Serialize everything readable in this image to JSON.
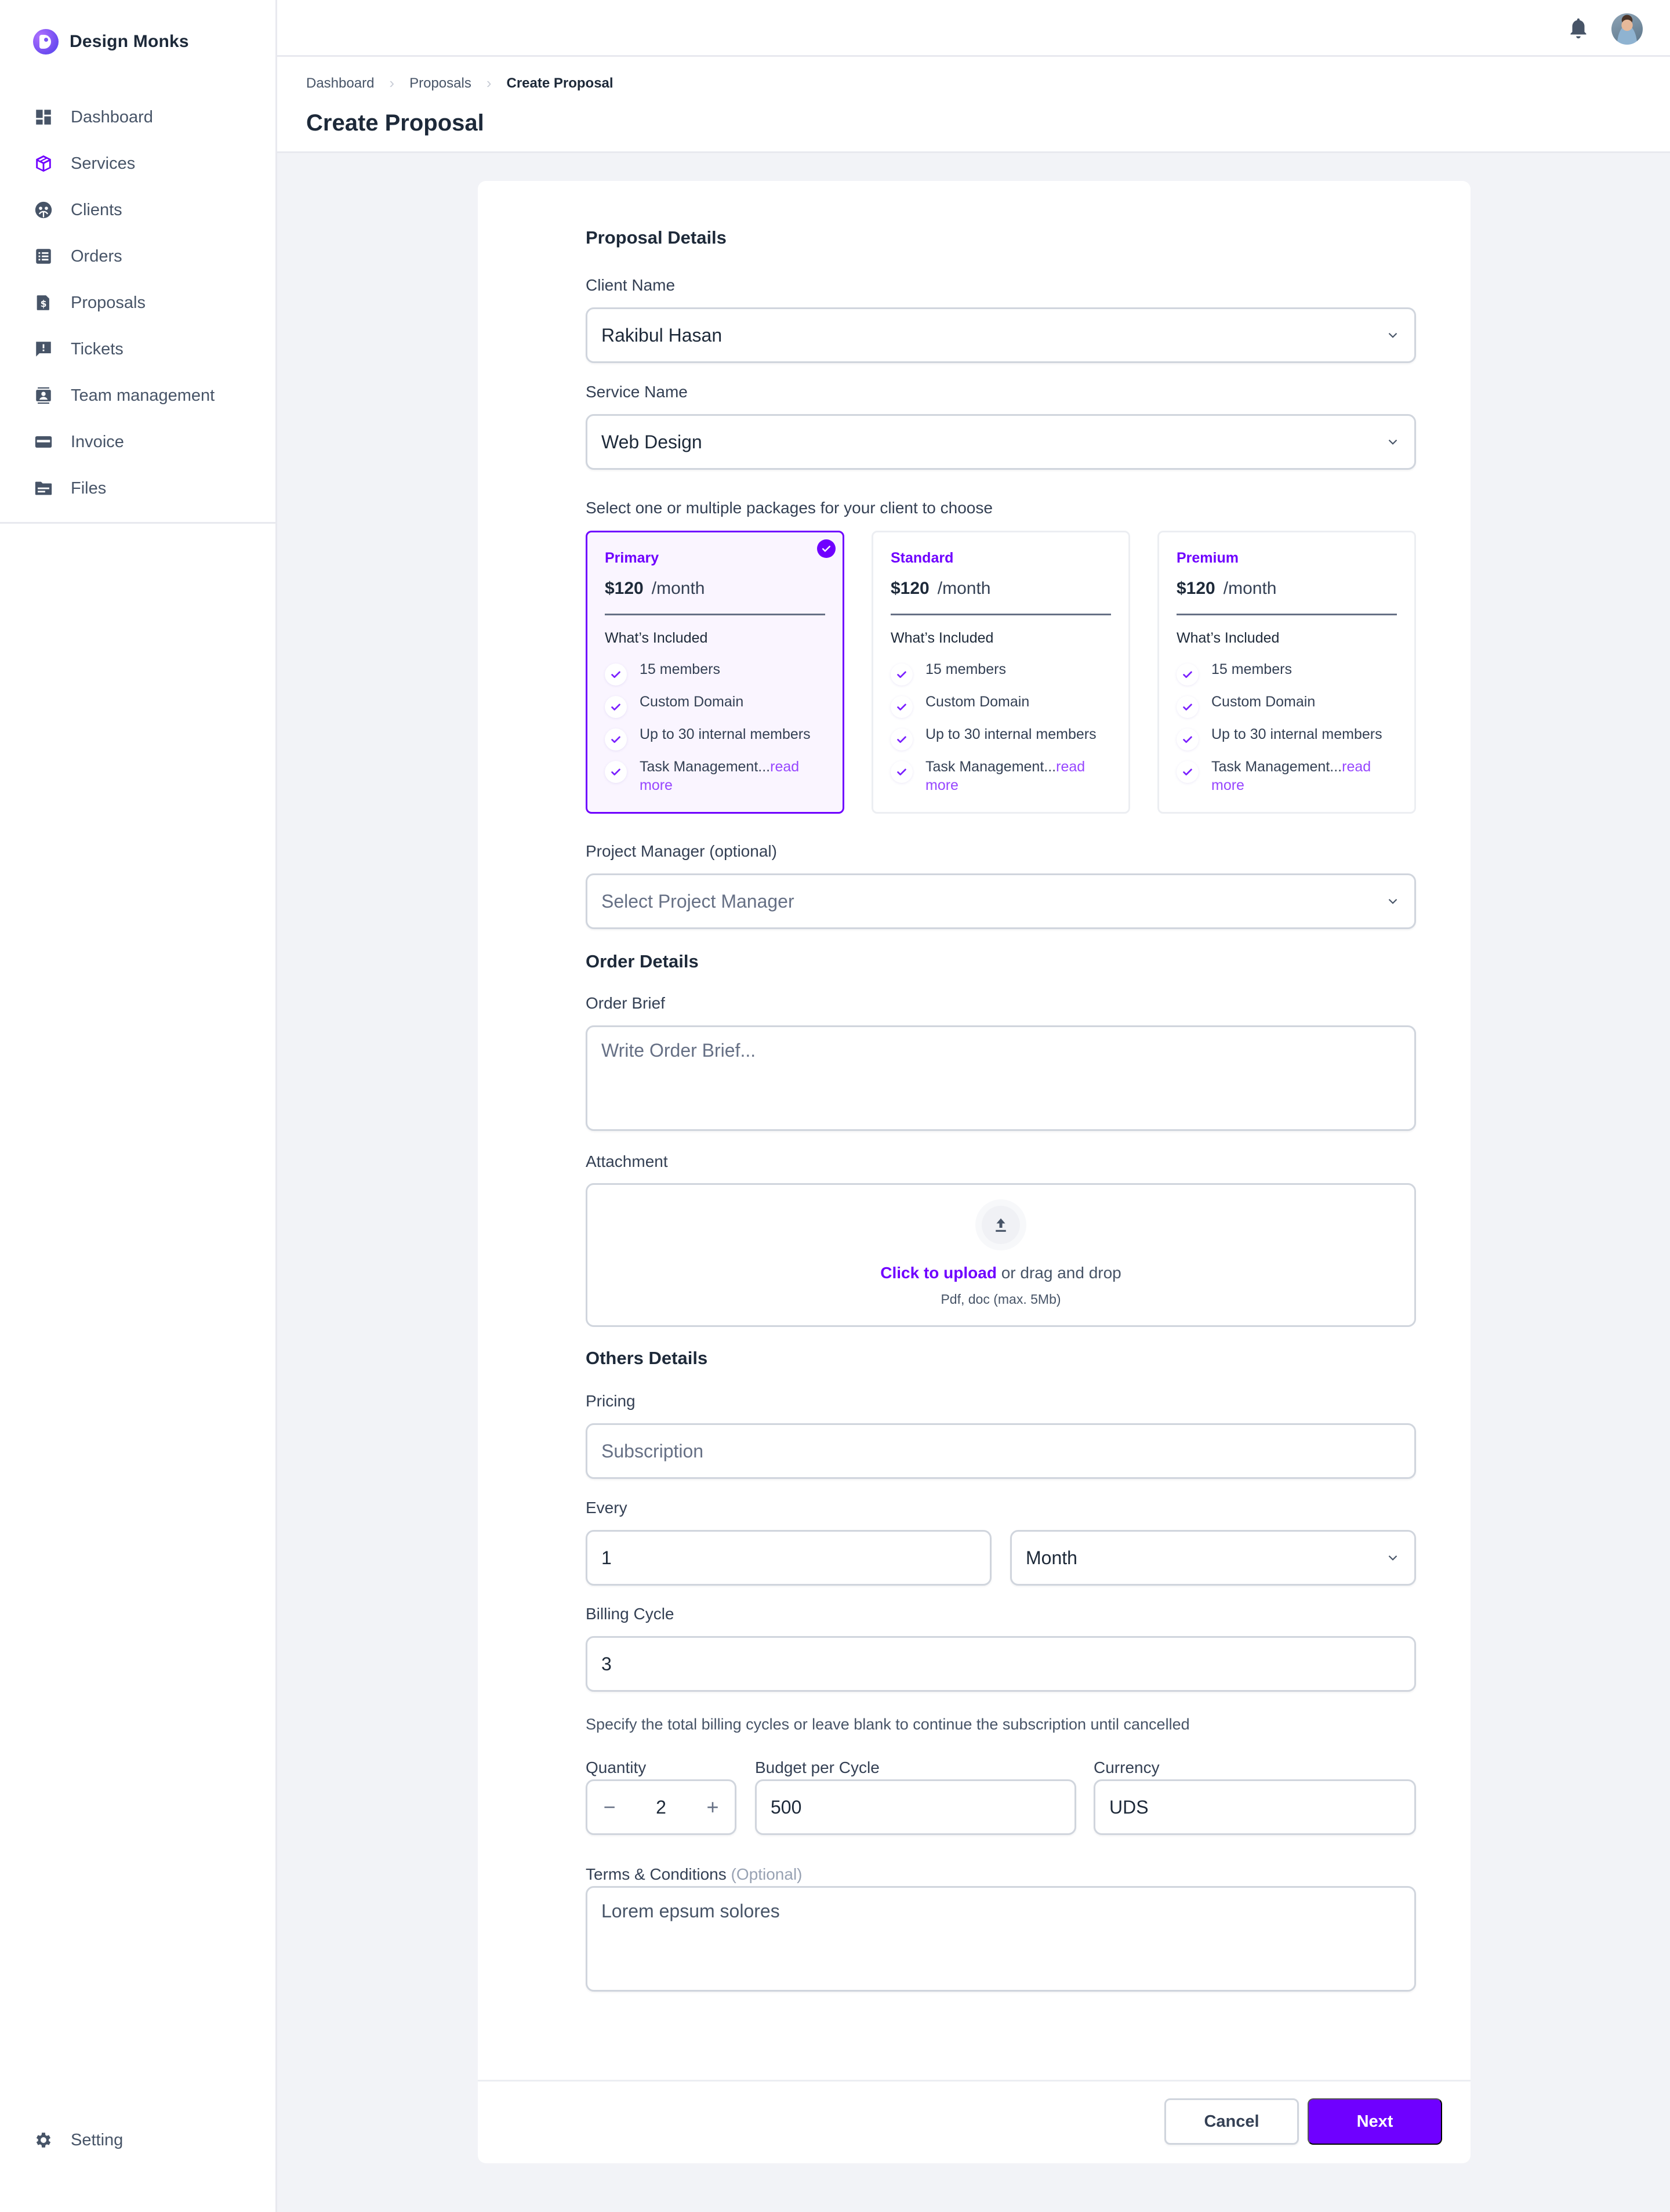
{
  "brand": {
    "name": "Design Monks",
    "logo_icon": "design-monks-logo"
  },
  "sidebar": {
    "items": [
      {
        "label": "Dashboard",
        "icon": "dashboard-icon",
        "active": false
      },
      {
        "label": "Services",
        "icon": "box-icon",
        "active": true
      },
      {
        "label": "Clients",
        "icon": "clients-icon",
        "active": false
      },
      {
        "label": "Orders",
        "icon": "list-icon",
        "active": false
      },
      {
        "label": "Proposals",
        "icon": "proposal-dollar-icon",
        "active": false
      },
      {
        "label": "Tickets",
        "icon": "ticket-alert-icon",
        "active": false
      },
      {
        "label": "Team management",
        "icon": "team-icon",
        "active": false
      },
      {
        "label": "Invoice",
        "icon": "card-icon",
        "active": false
      },
      {
        "label": "Files",
        "icon": "folder-icon",
        "active": false
      }
    ],
    "setting": {
      "label": "Setting",
      "icon": "gear-icon"
    }
  },
  "topbar": {
    "notification_icon": "bell-icon",
    "avatar": "user-avatar"
  },
  "breadcrumb": [
    "Dashboard",
    "Proposals",
    "Create Proposal"
  ],
  "page_title": "Create Proposal",
  "colors": {
    "accent": "#6f00ff",
    "accent_light": "#9747ff",
    "text": "#1d2939",
    "muted": "#475467",
    "border": "#d0d5dd",
    "bg": "#f2f3f7"
  },
  "form": {
    "proposal_details": {
      "title": "Proposal Details",
      "client_name": {
        "label": "Client Name",
        "value": "Rakibul Hasan"
      },
      "service_name": {
        "label": "Service Name",
        "value": "Web Design"
      },
      "packages_label": "Select one or multiple packages for your client to choose",
      "packages": [
        {
          "name": "Primary",
          "price": "$120",
          "period": "/month",
          "selected": true,
          "included_title": "What’s Included",
          "features": [
            "15 members",
            "Custom Domain",
            "Up to 30 internal members",
            "Task Management..."
          ],
          "read_more": "read more"
        },
        {
          "name": "Standard",
          "price": "$120",
          "period": "/month",
          "selected": false,
          "included_title": "What’s Included",
          "features": [
            "15 members",
            "Custom Domain",
            "Up to 30 internal members",
            "Task Management..."
          ],
          "read_more": "read more"
        },
        {
          "name": "Premium",
          "price": "$120",
          "period": "/month",
          "selected": false,
          "included_title": "What’s Included",
          "features": [
            "15 members",
            "Custom Domain",
            "Up to 30 internal members",
            "Task Management..."
          ],
          "read_more": "read more"
        }
      ],
      "project_manager": {
        "label": "Project Manager (optional)",
        "placeholder": "Select Project Manager"
      }
    },
    "order_details": {
      "title": "Order Details",
      "order_brief": {
        "label": "Order Brief",
        "placeholder": "Write Order Brief..."
      },
      "attachment": {
        "label": "Attachment",
        "link_text": "Click to upload",
        "rest_text": " or drag and drop",
        "hint": "Pdf, doc  (max. 5Mb)"
      }
    },
    "others_details": {
      "title": "Others Details",
      "pricing": {
        "label": "Pricing",
        "placeholder": "Subscription"
      },
      "every": {
        "label": "Every",
        "value": "1",
        "unit": "Month"
      },
      "billing_cycle": {
        "label": "Billing Cycle",
        "value": "3",
        "helper": "Specify the total billing cycles or leave blank to continue the subscription until cancelled"
      },
      "quantity": {
        "label": "Quantity",
        "value": "2",
        "minus": "−",
        "plus": "+"
      },
      "budget": {
        "label": "Budget per Cycle",
        "value": "500"
      },
      "currency": {
        "label": "Currency",
        "value": "UDS"
      },
      "terms": {
        "label": "Terms & Conditions",
        "optional": "(Optional)",
        "value": "Lorem epsum solores"
      }
    }
  },
  "footer": {
    "cancel_label": "Cancel",
    "next_label": "Next"
  }
}
